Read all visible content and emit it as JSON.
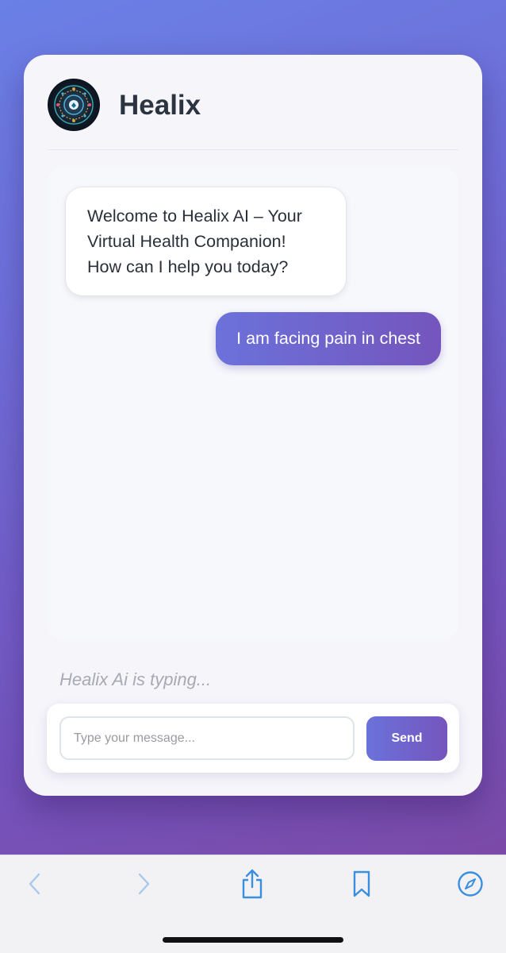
{
  "header": {
    "title": "Healix"
  },
  "chat": {
    "messages": [
      {
        "role": "bot",
        "text": "Welcome to Healix AI – Your\nVirtual Health Companion!\nHow can I help you today?"
      },
      {
        "role": "user",
        "text": "I am facing pain in chest"
      }
    ],
    "typing_indicator": "Healix Ai is typing..."
  },
  "composer": {
    "placeholder": "Type your message...",
    "value": "",
    "send_label": "Send"
  },
  "toolbar": {
    "icons": [
      "back-icon",
      "forward-icon",
      "share-icon",
      "bookmarks-icon",
      "compass-icon"
    ]
  },
  "colors": {
    "accent": "#6b72da",
    "accent_end": "#7455bd",
    "toolbar_icon": "#3a8fe0"
  }
}
